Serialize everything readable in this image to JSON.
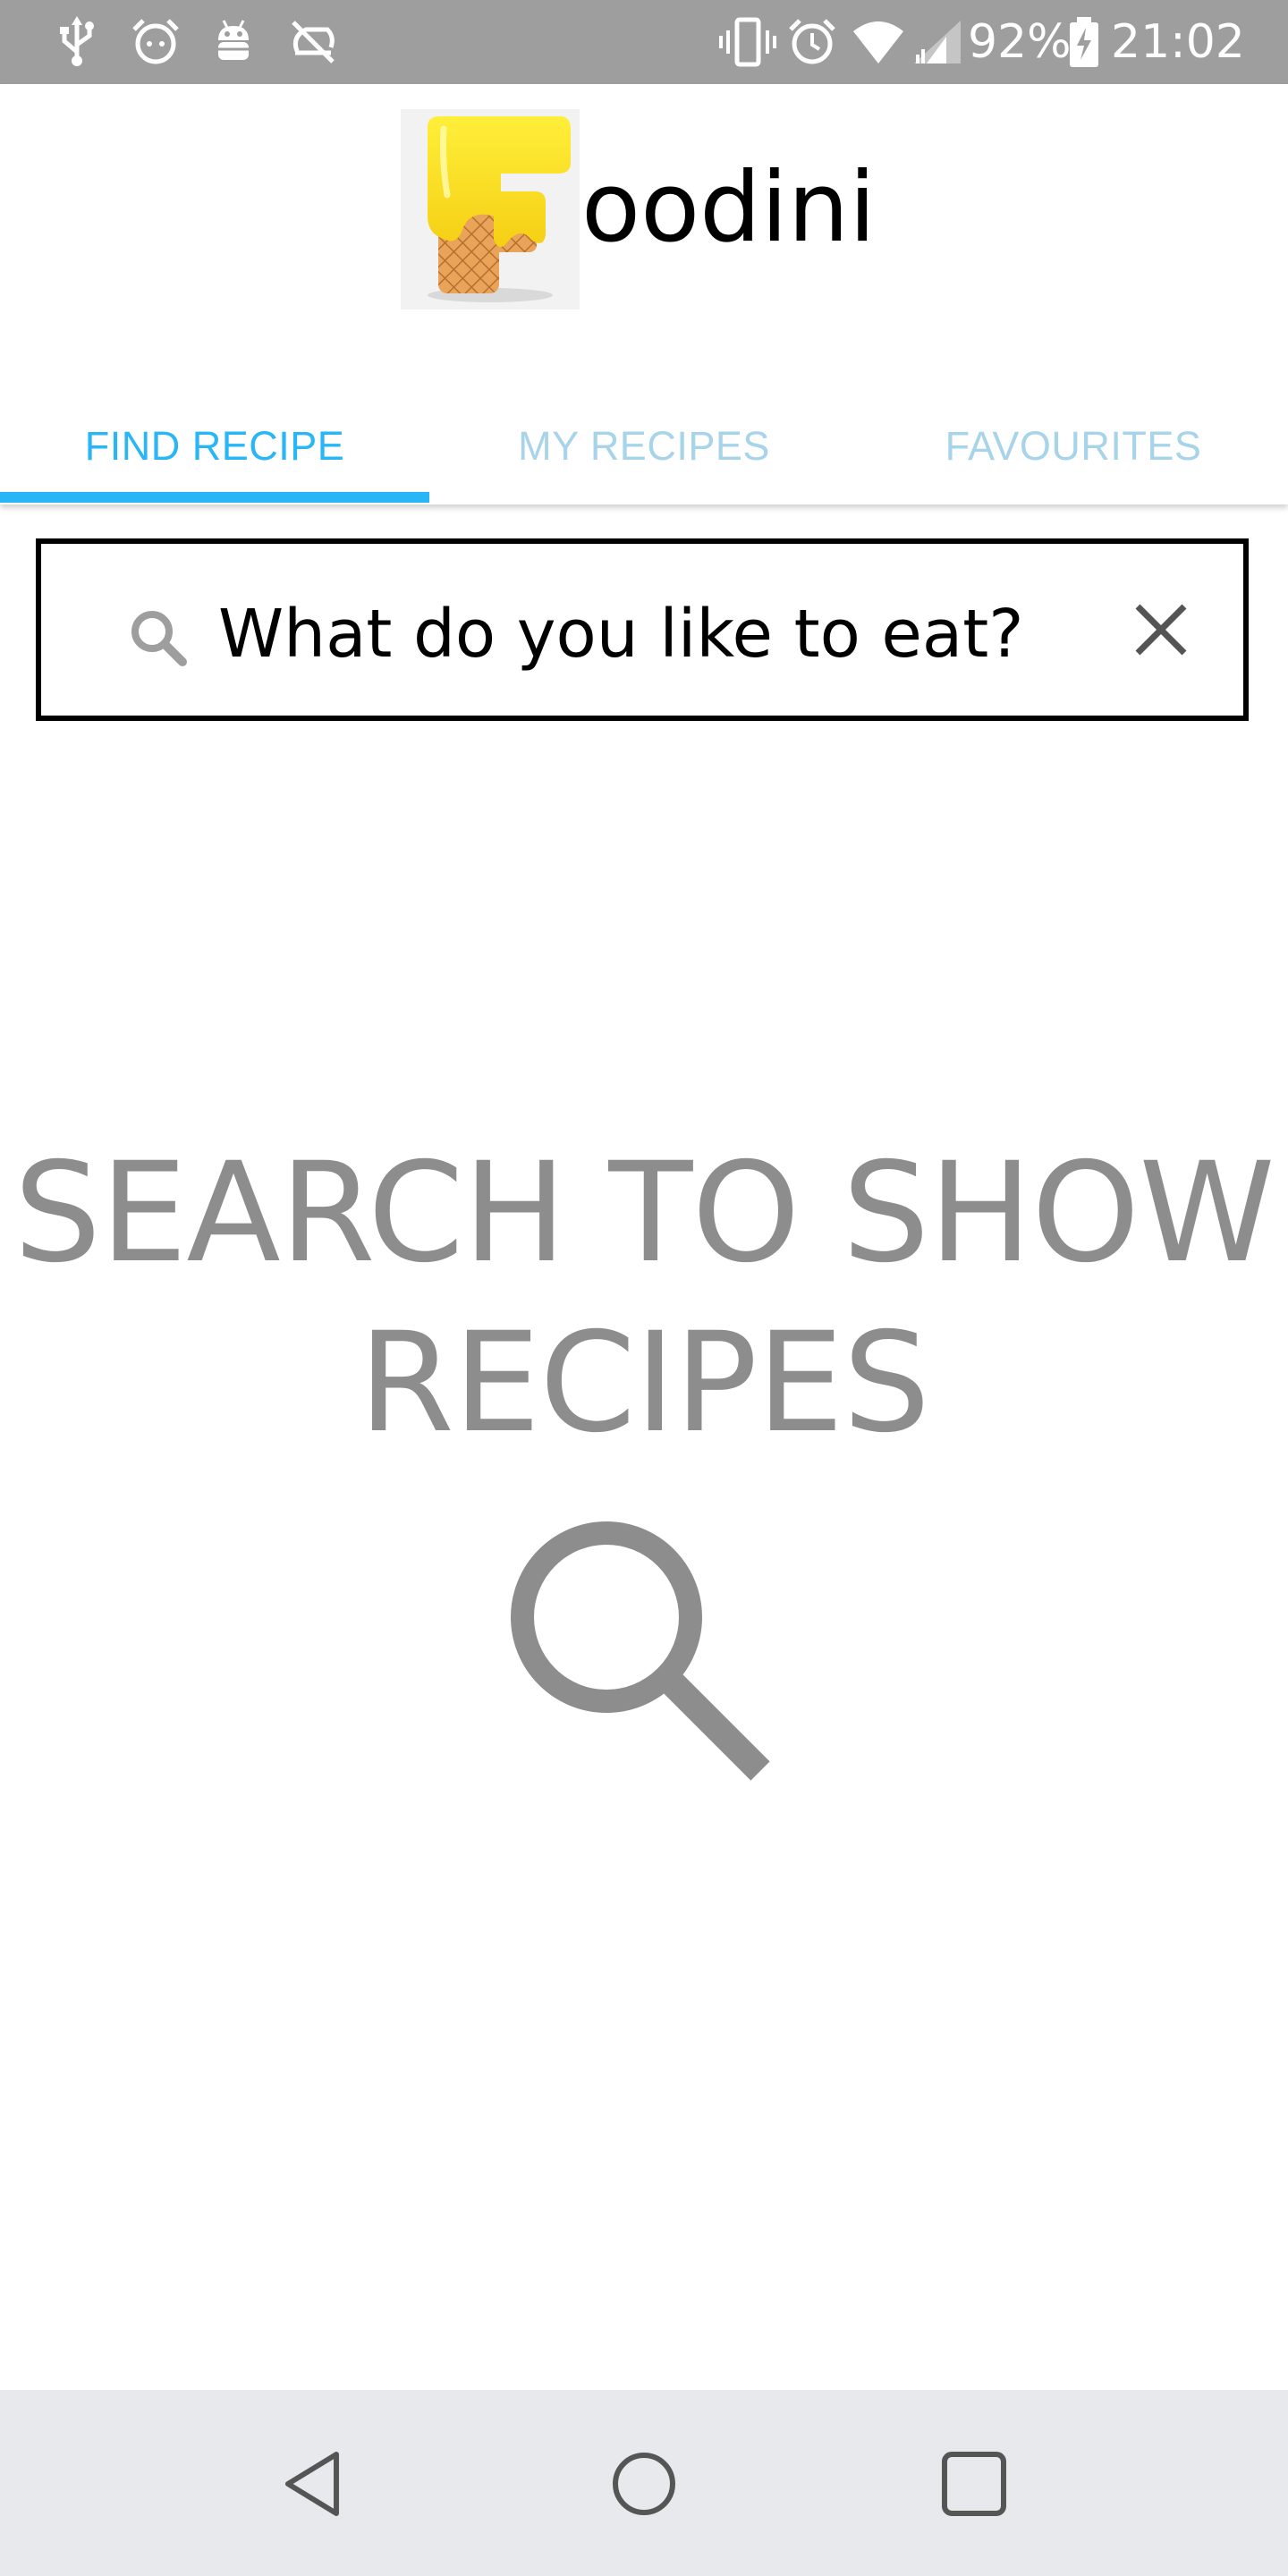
{
  "status_bar": {
    "left_icons": [
      "usb-icon",
      "alarm-face-icon",
      "android-debug-icon",
      "sync-off-icon"
    ],
    "right_icons": [
      "vibrate-icon",
      "alarm-icon",
      "wifi-icon",
      "signal-icon",
      "battery-charging-icon"
    ],
    "battery_percent": "92%",
    "time": "21:02"
  },
  "app": {
    "name_suffix": "oodini",
    "logo_icon": "foodini-logo-icon",
    "logo_letter": "F"
  },
  "tabs": [
    {
      "label": "FIND RECIPE",
      "active": true
    },
    {
      "label": "MY RECIPES",
      "active": false
    },
    {
      "label": "FAVOURITES",
      "active": false
    }
  ],
  "search": {
    "placeholder": "What do you like to eat?",
    "icon": "search-icon",
    "clear_icon": "close-icon"
  },
  "empty_state": {
    "line1": "SEARCH TO SHOW",
    "line2": "RECIPES",
    "icon": "search-icon"
  },
  "nav": {
    "back_icon": "back-icon",
    "home_icon": "home-icon",
    "recents_icon": "recents-icon"
  },
  "colors": {
    "accent": "#29b6f6",
    "tab_inactive": "#a8d4ea",
    "status_bar": "#9e9e9e",
    "empty_text": "#8d8d8d",
    "nav_bar": "#e8e9ec"
  }
}
